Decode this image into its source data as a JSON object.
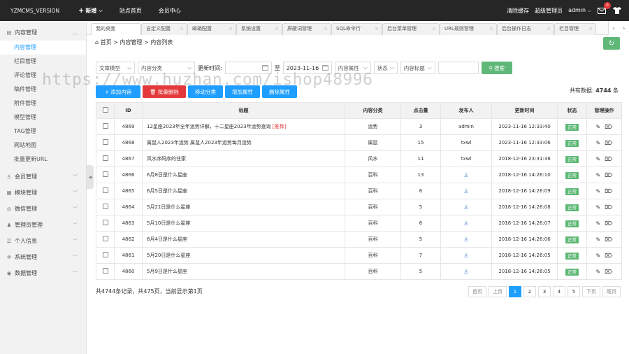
{
  "colors": {
    "primary": "#1E9FFF",
    "green": "#5FB878",
    "red": "#e4393c",
    "topbar": "#262626"
  },
  "topbar": {
    "brand": "YZMCMS_VERSION",
    "new_label": "新增",
    "nav": [
      "站点首页",
      "会员中心"
    ],
    "clear_cache": "清除缓存",
    "role": "超级管理员",
    "user": "admin",
    "msg_count": "0"
  },
  "sidebar": {
    "groups": [
      {
        "label": "内容管理",
        "icon": "list-icon",
        "items": [
          "内容管理",
          "栏目管理",
          "评论管理",
          "稿件管理",
          "附件管理",
          "模型管理",
          "TAG管理",
          "网站地图",
          "批量更新URL"
        ]
      },
      {
        "label": "会员管理",
        "icon": "user-icon"
      },
      {
        "label": "模块管理",
        "icon": "module-icon"
      },
      {
        "label": "微信管理",
        "icon": "wechat-icon"
      },
      {
        "label": "管理员管理",
        "icon": "admin-icon"
      },
      {
        "label": "个人信息",
        "icon": "profile-icon"
      },
      {
        "label": "系统管理",
        "icon": "gear-icon"
      },
      {
        "label": "数据管理",
        "icon": "database-icon"
      }
    ]
  },
  "tabs": [
    "我的桌面",
    "自定义配置",
    "邮箱配置",
    "系统设置",
    "屏蔽词管理",
    "SQL命令行",
    "后台菜单管理",
    "URL规则管理",
    "后台操作日志",
    "栏目管理"
  ],
  "breadcrumb": [
    "首页",
    "内容管理",
    "内容列表"
  ],
  "filters": {
    "model": "文章模型",
    "category": "内容分类",
    "time_label": "更新时间:",
    "date_start": "",
    "to": "至",
    "date_end": "2023-11-16",
    "attr": "内容属性",
    "status": "状态",
    "field": "内容标题",
    "keyword": "",
    "search": "搜索"
  },
  "actions": [
    "添加内容",
    "批量删除",
    "移动分类",
    "增加属性",
    "删除属性"
  ],
  "total": {
    "label": "共有数据:",
    "count": "4744",
    "unit": "条"
  },
  "table": {
    "headers": [
      "ID",
      "标题",
      "内容分类",
      "点击量",
      "发布人",
      "更新时间",
      "状态",
      "管理操作"
    ],
    "rows": [
      {
        "id": "4869",
        "title": "12星座2023年全年运势详解，十二星座2023年运势查询",
        "tag": "[推荐]",
        "cat": "运势",
        "hits": "3",
        "pub": "admin",
        "time": "2023-11-16 12:33:40",
        "status": "正常"
      },
      {
        "id": "4868",
        "title": "属鼠人2023年运势 属鼠人2023年运势每月运势",
        "tag": "",
        "cat": "属鼠",
        "hits": "15",
        "pub": "txwl",
        "time": "2023-11-16 12:33:06",
        "status": "正常"
      },
      {
        "id": "4867",
        "title": "风水序码序的住家",
        "tag": "",
        "cat": "风水",
        "hits": "11",
        "pub": "txwl",
        "time": "2018-12-16 23:31:38",
        "status": "正常"
      },
      {
        "id": "4866",
        "title": "6月8日是什么星座",
        "tag": "",
        "cat": "百科",
        "hits": "13",
        "pub": "",
        "time": "2018-12-16 14:26:10",
        "status": "正常"
      },
      {
        "id": "4865",
        "title": "6月5日是什么星座",
        "tag": "",
        "cat": "百科",
        "hits": "6",
        "pub": "",
        "time": "2018-12-16 14:26:09",
        "status": "正常"
      },
      {
        "id": "4864",
        "title": "5月21日是什么星座",
        "tag": "",
        "cat": "百科",
        "hits": "5",
        "pub": "",
        "time": "2018-12-16 14:26:08",
        "status": "正常"
      },
      {
        "id": "4863",
        "title": "5月10日是什么星座",
        "tag": "",
        "cat": "百科",
        "hits": "6",
        "pub": "",
        "time": "2018-12-16 14:26:07",
        "status": "正常"
      },
      {
        "id": "4862",
        "title": "6月4日是什么星座",
        "tag": "",
        "cat": "百科",
        "hits": "5",
        "pub": "",
        "time": "2018-12-16 14:26:06",
        "status": "正常"
      },
      {
        "id": "4861",
        "title": "5月20日是什么星座",
        "tag": "",
        "cat": "百科",
        "hits": "7",
        "pub": "",
        "time": "2018-12-16 14:26:05",
        "status": "正常"
      },
      {
        "id": "4860",
        "title": "5月9日是什么星座",
        "tag": "",
        "cat": "百科",
        "hits": "5",
        "pub": "",
        "time": "2018-12-16 14:26:05",
        "status": "正常"
      }
    ]
  },
  "footer": {
    "info": "共4744条记录，共475页，当前显示第1页",
    "pager": [
      "首页",
      "上页",
      "1",
      "2",
      "3",
      "4",
      "5",
      "下页",
      "尾页"
    ]
  },
  "watermark": "https://www.huzhan.com/ishop48996"
}
